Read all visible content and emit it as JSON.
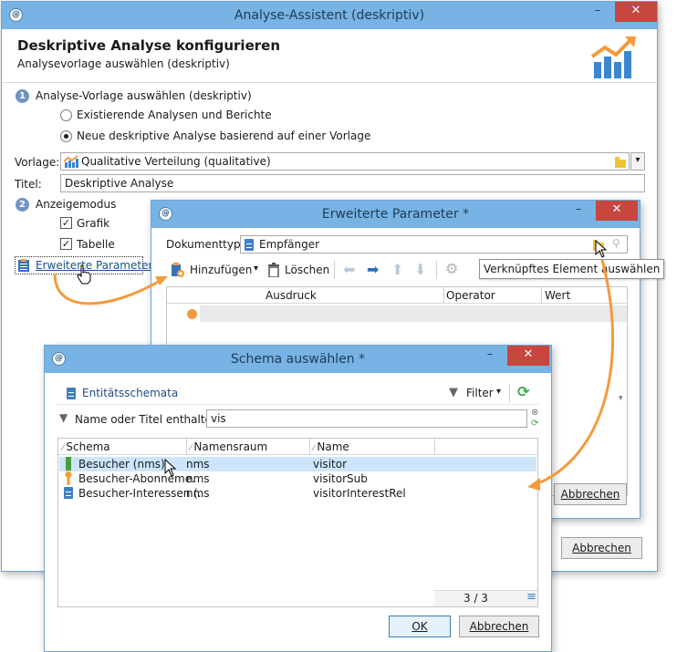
{
  "main_window": {
    "title": "Analyse-Assistent (deskriptiv)",
    "header_title": "Deskriptive Analyse konfigurieren",
    "header_subtitle": "Analysevorlage auswählen (deskriptiv)",
    "step1": {
      "number": "1",
      "label": "Analyse-Vorlage auswählen (deskriptiv)"
    },
    "radio_existing": "Existierende Analysen und Berichte",
    "radio_new": "Neue deskriptive Analyse basierend auf einer Vorlage",
    "template_label": "Vorlage:",
    "template_value": "Qualitative Verteilung (qualitative)",
    "title_label": "Titel:",
    "title_value": "Deskriptive Analyse",
    "step2": {
      "number": "2",
      "label": "Anzeigemodus"
    },
    "check_graph": "Grafik",
    "check_table": "Tabelle",
    "advanced_link": "Erweiterte Parameter...",
    "cancel_label": "Abbrechen"
  },
  "params_window": {
    "title": "Erweiterte Parameter *",
    "doctype_label": "Dokumenttyp:",
    "doctype_value": "Empfänger",
    "add_label": "Hinzufügen",
    "delete_label": "Löschen",
    "tooltip": "Verknüpftes Element auswählen",
    "columns": [
      "Ausdruck",
      "Operator",
      "Wert"
    ],
    "cancel_label": "Abbrechen"
  },
  "schema_window": {
    "title": "Schema auswählen *",
    "entity_label": "Entitätsschemata",
    "filter_label": "Filter",
    "search_label": "Name oder Titel enthalten:",
    "search_value": "vis",
    "columns": [
      "Schema",
      "Namensraum",
      "Name"
    ],
    "rows": [
      {
        "schema": "Besucher (nms)",
        "namespace": "nms",
        "name": "visitor"
      },
      {
        "schema": "Besucher-Abonnemе.",
        "namespace": "nms",
        "name": "visitorSub"
      },
      {
        "schema": "Besucher-Interessen (.",
        "namespace": "nms",
        "name": "visitorInterestRel"
      }
    ],
    "count": "3 / 3",
    "ok_label": "OK",
    "cancel_label": "Abbrechen"
  },
  "colors": {
    "titlebar": "#77b3e4",
    "close": "#c7463d",
    "accent_orange": "#f39a3c",
    "selection": "#cce5fb"
  }
}
